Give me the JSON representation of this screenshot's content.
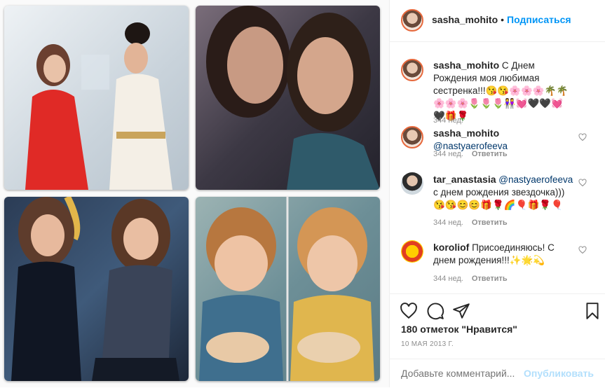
{
  "header": {
    "username": "sasha_mohito",
    "separator": "•",
    "follow_label": "Подписаться"
  },
  "caption": {
    "username": "sasha_mohito",
    "text": "С Днем Рождения моя любимая сестренка!!!😘😘🌸🌸🌸🌴🌴🌸🌸🌸🌷🌷🌷👭💓🖤🖤💓🖤🎁🌹",
    "time": "344 нед."
  },
  "comments": [
    {
      "username": "sasha_mohito",
      "mention": "@nastyaerofeeva",
      "text": "",
      "time": "344 нед.",
      "reply": "Ответить"
    },
    {
      "username": "tar_anastasia",
      "mention": "@nastyaerofeeva",
      "text": "с днем рождения звездочка)))😘😘😊😊🎁🌹🌈🎈🎁🌹🎈",
      "time": "344 нед.",
      "reply": "Ответить"
    },
    {
      "username": "koroliof",
      "mention": "",
      "text": "Присоединяюсь! С днем рождения!!!✨🌟💫",
      "time": "344 нед.",
      "reply": "Ответить"
    }
  ],
  "likes": "180 отметок \"Нравится\"",
  "date": "10 МАЯ 2013 Г.",
  "add_comment": {
    "placeholder": "Добавьте комментарий...",
    "post_label": "Опубликовать"
  },
  "colors": {
    "link": "#0095f6",
    "muted": "#8e8e8e",
    "post_disabled": "#b2dffc"
  }
}
